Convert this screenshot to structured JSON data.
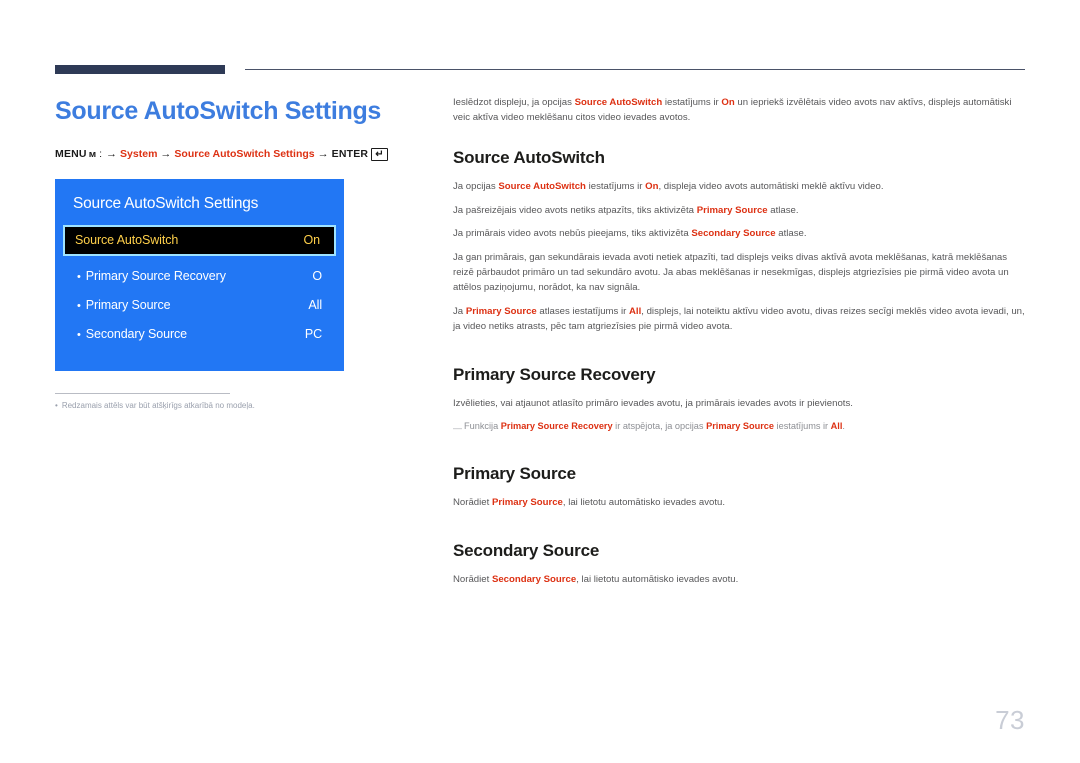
{
  "page": {
    "title": "Source AutoSwitch Settings",
    "number": "73",
    "language": "lv"
  },
  "menu_path": {
    "menu_label": "MENU",
    "menu_icon": "menu-glyph-icon",
    "colon": ":",
    "arrow": "→",
    "step1": "System",
    "step2": "Source AutoSwitch Settings",
    "enter_label": "ENTER",
    "enter_icon": "↵"
  },
  "osd": {
    "title": "Source AutoSwitch Settings",
    "rows": [
      {
        "label": "Source AutoSwitch",
        "value": "On",
        "selected": true,
        "sub": false
      },
      {
        "label": "Primary Source Recovery",
        "value": "O",
        "selected": false,
        "sub": true
      },
      {
        "label": "Primary Source",
        "value": "All",
        "selected": false,
        "sub": true
      },
      {
        "label": "Secondary Source",
        "value": "PC",
        "selected": false,
        "sub": true
      }
    ],
    "colors": {
      "panel_bg": "#2277f4",
      "selected_bg": "#000000",
      "selected_border": "#9fe3ff",
      "selected_text": "#ffd04a",
      "text": "#ffffff"
    }
  },
  "footnote": {
    "dash": "•",
    "text": "Redzamais attēls var būt atšķirīgs atkarībā no modeļa."
  },
  "content": {
    "intro": {
      "part1": "Ieslēdzot displeju, ja opcijas ",
      "hl1": "Source AutoSwitch",
      "part2": " iestatījums ir ",
      "hl2": "On",
      "part3": " un iepriekš izvēlētais video avots nav aktīvs, displejs automātiski veic aktīva video meklēšanu citos video ievades avotos."
    },
    "sections": [
      {
        "heading": "Source AutoSwitch",
        "paragraphs": [
          {
            "part1": "Ja opcijas ",
            "hl1": "Source AutoSwitch",
            "part2": " iestatījums ir ",
            "hl2": "On",
            "part3": ", displeja video avots automātiski meklē aktīvu video."
          },
          {
            "part1": "Ja pašreizējais video avots netiks atpazīts, tiks aktivizēta ",
            "hl1": "Primary Source",
            "part2": " atlase."
          },
          {
            "part1": "Ja primārais video avots nebūs pieejams, tiks aktivizēta ",
            "hl1": "Secondary Source",
            "part2": " atlase."
          },
          {
            "part1": "Ja gan primārais, gan sekundārais ievada avoti netiek atpazīti, tad displejs veiks divas aktīvā avota meklēšanas, katrā meklēšanas reizē pārbaudot primāro un tad sekundāro avotu. Ja abas meklēšanas ir nesekmīgas, displejs atgriezīsies pie pirmā video avota un attēlos paziņojumu, norādot, ka nav signāla."
          },
          {
            "part1": "Ja ",
            "hl1": "Primary Source",
            "part2": " atlases iestatījums ir ",
            "hl2": "All",
            "part3": ", displejs, lai noteiktu aktīvu video avotu, divas reizes secīgi meklēs video avota ievadi, un, ja video netiks atrasts, pēc tam atgriezīsies pie pirmā video avota."
          }
        ],
        "note": null
      },
      {
        "heading": "Primary Source Recovery",
        "paragraphs": [
          {
            "part1": "Izvēlieties, vai atjaunot atlasīto primāro ievades avotu, ja primārais ievades avots ir pievienots."
          }
        ],
        "note": {
          "dash": "―",
          "part1": "Funkcija ",
          "hl1": "Primary Source Recovery",
          "part2": " ir atspējota, ja opcijas ",
          "hl2": "Primary Source",
          "part3": " iestatījums ir ",
          "hl3": "All",
          "part4": "."
        }
      },
      {
        "heading": "Primary Source",
        "paragraphs": [
          {
            "part1": "Norādiet ",
            "hl1": "Primary Source",
            "part2": ", lai lietotu automātisko ievades avotu."
          }
        ],
        "note": null
      },
      {
        "heading": "Secondary Source",
        "paragraphs": [
          {
            "part1": "Norādiet ",
            "hl1": "Secondary Source",
            "part2": ", lai lietotu automātisko ievades avotu."
          }
        ],
        "note": null
      }
    ]
  },
  "colors": {
    "accent_blue": "#3d7ddf",
    "highlight_red": "#dd3113",
    "rule_navy": "#2e3a56",
    "body_gray": "#58585a",
    "page_number_gray": "#c9cdd6"
  }
}
